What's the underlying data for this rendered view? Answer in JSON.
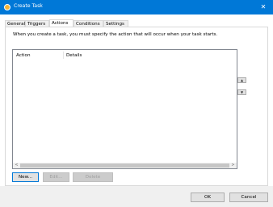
{
  "window": {
    "title": "Create Task",
    "close_glyph": "✕",
    "icon": "task-scheduler-icon"
  },
  "tabs": [
    {
      "label": "General",
      "active": false
    },
    {
      "label": "Triggers",
      "active": false
    },
    {
      "label": "Actions",
      "active": true
    },
    {
      "label": "Conditions",
      "active": false
    },
    {
      "label": "Settings",
      "active": false
    }
  ],
  "actions": {
    "description": "When you create a task, you must specify the action that will occur when your task starts.",
    "columns": [
      "Action",
      "Details"
    ],
    "rows": [],
    "move_up_glyph": "▲",
    "move_down_glyph": "▼",
    "scroll_left_glyph": "<",
    "scroll_right_glyph": ">",
    "new_label": "New...",
    "edit_label": "Edit...",
    "delete_label": "Delete"
  },
  "footer": {
    "ok_label": "OK",
    "cancel_label": "Cancel"
  },
  "colors": {
    "titlebar": "#0078d7",
    "focus_border": "#0078d7"
  }
}
